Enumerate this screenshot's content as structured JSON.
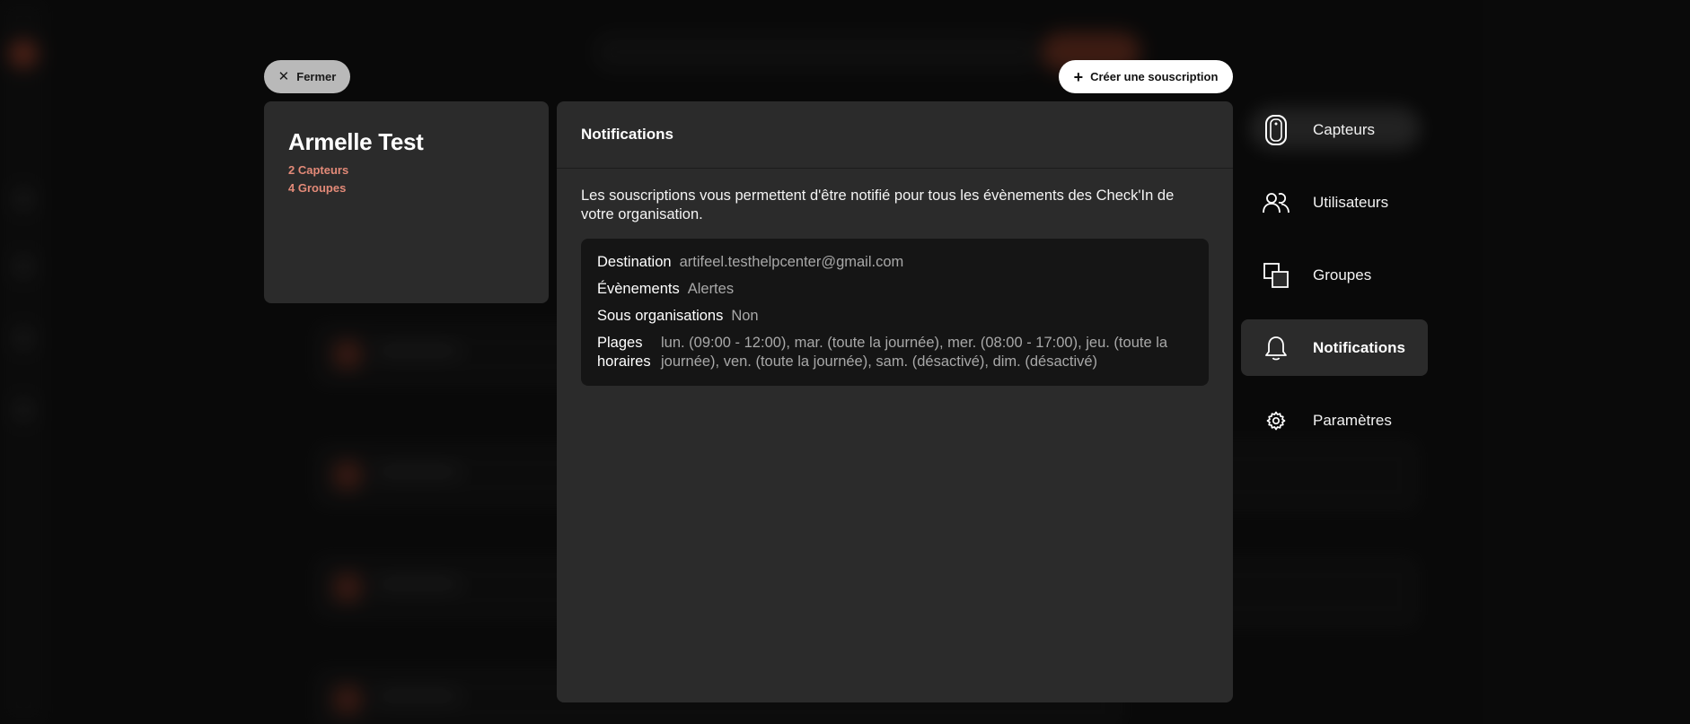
{
  "top_bar": {
    "close_label": "Fermer",
    "create_label": "Créer une souscription"
  },
  "profile": {
    "name": "Armelle Test",
    "sensors": "2 Capteurs",
    "groups": "4 Groupes"
  },
  "panel": {
    "title": "Notifications",
    "description": "Les souscriptions vous permettent d'être notifié pour tous les évènements des Check'In de votre organisation."
  },
  "subscription": {
    "destination_label": "Destination",
    "destination_value": "artifeel.testhelpcenter@gmail.com",
    "events_label": "Évènements",
    "events_value": "Alertes",
    "suborg_label": "Sous organisations",
    "suborg_value": "Non",
    "schedule_label": "Plages horaires",
    "schedule_value": "lun. (09:00 - 12:00), mar. (toute la journée), mer. (08:00 - 17:00), jeu. (toute la journée), ven. (toute la journée), sam. (désactivé), dim. (désactivé)"
  },
  "nav": {
    "items": [
      {
        "label": "Capteurs",
        "icon": "sensor-icon"
      },
      {
        "label": "Utilisateurs",
        "icon": "users-icon"
      },
      {
        "label": "Groupes",
        "icon": "groups-icon"
      },
      {
        "label": "Notifications",
        "icon": "bell-icon",
        "active": true
      },
      {
        "label": "Paramètres",
        "icon": "gear-icon"
      }
    ]
  },
  "colors": {
    "accent": "#e38a78",
    "panel": "#2b2b2b",
    "card": "#151515"
  }
}
